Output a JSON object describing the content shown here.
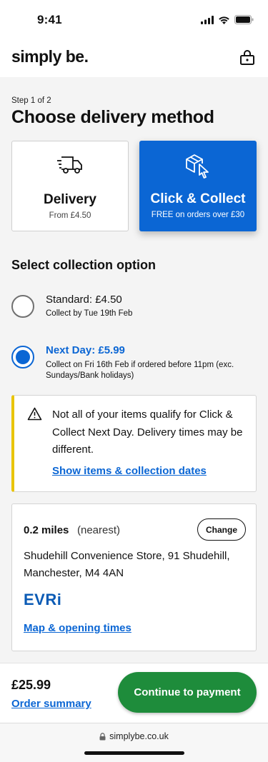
{
  "status_bar": {
    "time": "9:41"
  },
  "header": {
    "logo": "simply be."
  },
  "step": "Step 1 of 2",
  "title": "Choose delivery method",
  "methods": [
    {
      "title": "Delivery",
      "sub": "From £4.50",
      "selected": false,
      "icon": "truck-icon"
    },
    {
      "title": "Click & Collect",
      "sub": "FREE on orders over £30",
      "selected": true,
      "icon": "parcel-cursor-icon"
    }
  ],
  "collection": {
    "heading": "Select collection option",
    "options": [
      {
        "title": "Standard: £4.50",
        "sub": "Collect by Tue 19th Feb",
        "selected": false
      },
      {
        "title": "Next Day: £5.99",
        "sub": "Collect on Fri 16th Feb if ordered before 11pm (exc. Sundays/Bank holidays)",
        "selected": true
      }
    ]
  },
  "notice": {
    "text": "Not all of your items qualify for Click & Collect Next Day. Delivery times may be different.",
    "link": "Show items & collection dates",
    "accent": "#e9c400",
    "icon": "warning-icon"
  },
  "store": {
    "distance": "0.2 miles",
    "nearest": "(nearest)",
    "change_label": "Change",
    "address": "Shudehill Convenience Store, 91 Shudehill, Manchester, M4 4AN",
    "carrier": "EVRi",
    "map_link": "Map & opening times"
  },
  "footer": {
    "total": "£25.99",
    "summary_link": "Order summary",
    "continue_label": "Continue to payment"
  },
  "browser": {
    "url": "simplybe.co.uk"
  },
  "colors": {
    "primary": "#0b66d4",
    "success": "#1e8c3b",
    "warning": "#e9c400"
  }
}
